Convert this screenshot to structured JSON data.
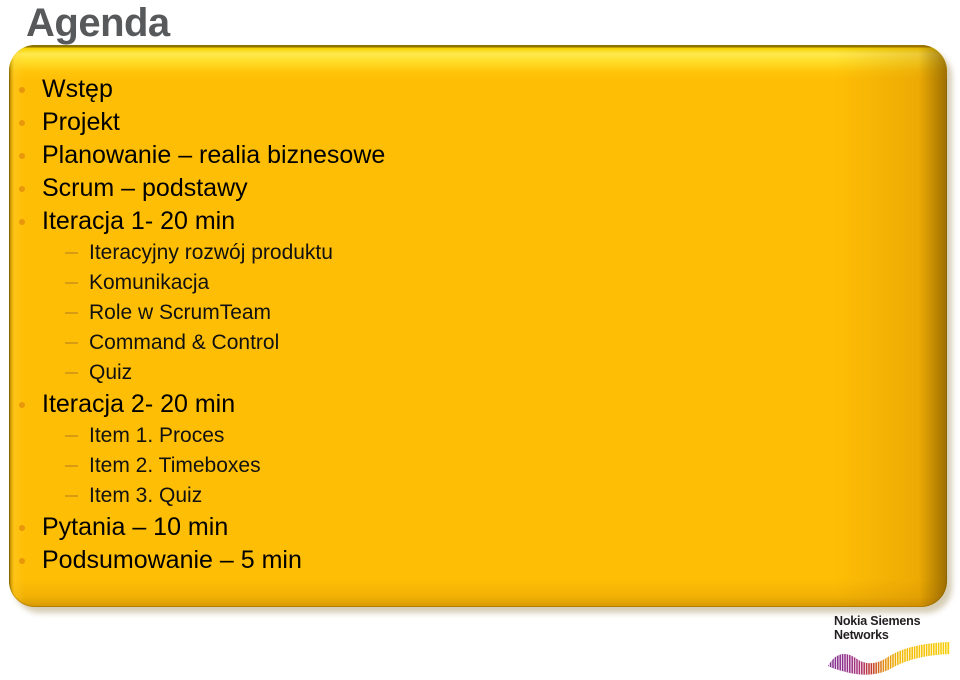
{
  "slide": {
    "title": "Agenda",
    "title_color": "#58595B",
    "background_color": "#FFFFFF",
    "panel_color": "#FFBE06",
    "panel_bevel_highlight": "#FFE94F",
    "panel_bevel_shadow": "#8D7400",
    "bullet_marker_color": "#E8960A",
    "dash_marker_color": "#D99B12",
    "text_color": "#000000"
  },
  "agenda": {
    "items": [
      {
        "level": 1,
        "text": "Wstęp"
      },
      {
        "level": 1,
        "text": "Projekt"
      },
      {
        "level": 1,
        "text": "Planowanie – realia biznesowe"
      },
      {
        "level": 1,
        "text": "Scrum – podstawy"
      },
      {
        "level": 1,
        "text": "Iteracja 1- 20 min"
      },
      {
        "level": 2,
        "text": "Iteracyjny rozwój produktu"
      },
      {
        "level": 2,
        "text": "Komunikacja"
      },
      {
        "level": 2,
        "text": "Role w ScrumTeam"
      },
      {
        "level": 2,
        "text": "Command & Control"
      },
      {
        "level": 2,
        "text": "Quiz"
      },
      {
        "level": 1,
        "text": "Iteracja 2- 20 min"
      },
      {
        "level": 2,
        "text": "Item 1. Proces"
      },
      {
        "level": 2,
        "text": "Item 2. Timeboxes"
      },
      {
        "level": 2,
        "text": "Item 3. Quiz"
      },
      {
        "level": 1,
        "text": "Pytania – 10 min"
      },
      {
        "level": 1,
        "text": "Podsumowanie – 5 min"
      }
    ]
  },
  "logo": {
    "line1": "Nokia Siemens",
    "line2": "Networks",
    "wave_color_start": "#7B2D8E",
    "wave_color_mid": "#C0392B",
    "wave_color_end": "#F5C400"
  }
}
